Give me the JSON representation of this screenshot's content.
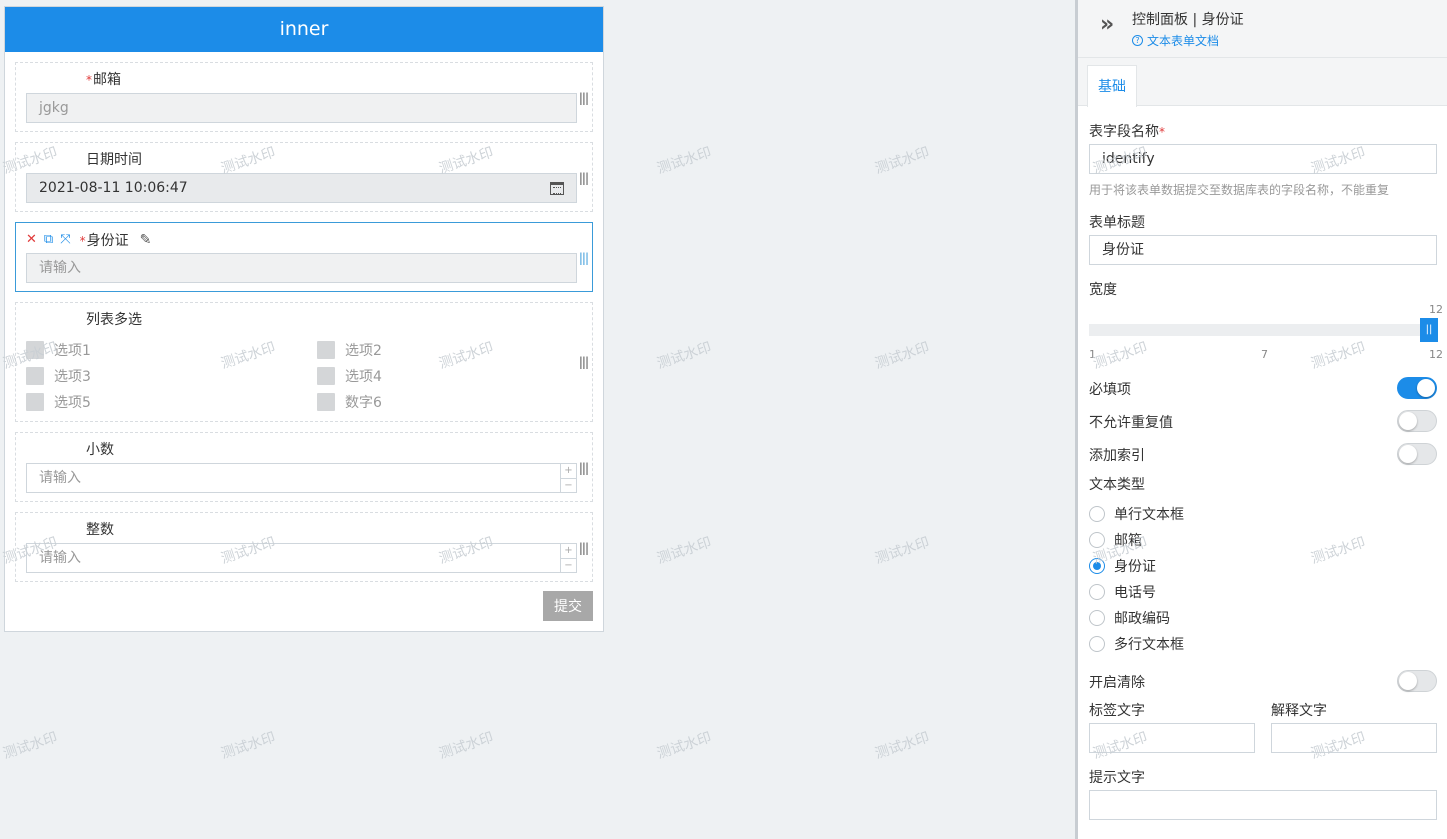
{
  "form": {
    "title": "inner",
    "fields": {
      "email": {
        "label": "邮箱",
        "value": "jgkg"
      },
      "datetime": {
        "label": "日期时间",
        "value": "2021-08-11 10:06:47"
      },
      "idcard": {
        "label": "身份证",
        "placeholder": "请输入"
      },
      "multiselect": {
        "label": "列表多选",
        "options": [
          "选项1",
          "选项2",
          "选项3",
          "选项4",
          "选项5",
          "数字6"
        ]
      },
      "decimal": {
        "label": "小数",
        "placeholder": "请输入"
      },
      "integer": {
        "label": "整数",
        "placeholder": "请输入"
      }
    },
    "submit_label": "提交"
  },
  "panel": {
    "title": "控制面板 | 身份证",
    "doc_link": "文本表单文档",
    "tab": "基础",
    "field_name_label": "表字段名称",
    "field_name_value": "identify",
    "field_name_help": "用于将该表单数据提交至数据库表的字段名称，不能重复",
    "form_title_label": "表单标题",
    "form_title_value": "身份证",
    "width_label": "宽度",
    "width": {
      "value": 12,
      "min": 1,
      "mid": 7,
      "max": 12,
      "min_label": "1",
      "mid_label": "7",
      "max_label": "12",
      "value_label": "12"
    },
    "required_label": "必填项",
    "required_on": true,
    "unique_label": "不允许重复值",
    "unique_on": false,
    "index_label": "添加索引",
    "index_on": false,
    "text_type_label": "文本类型",
    "text_types": [
      "单行文本框",
      "邮箱",
      "身份证",
      "电话号",
      "邮政编码",
      "多行文本框"
    ],
    "text_type_selected": "身份证",
    "clear_label": "开启清除",
    "clear_on": false,
    "tag_text_label": "标签文字",
    "explain_text_label": "解释文字",
    "hint_text_label": "提示文字"
  },
  "watermark": "测试水印",
  "colors": {
    "primary": "#1c8ce8",
    "danger": "#e03a3a"
  }
}
